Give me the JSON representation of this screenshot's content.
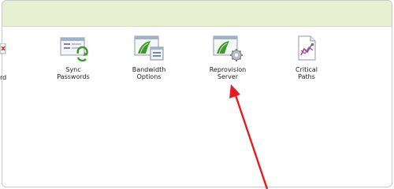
{
  "toolbar": {
    "partial_label": "rd",
    "tools": [
      {
        "line1": "Sync",
        "line2": "Passwords",
        "icon": "sync-passwords-icon"
      },
      {
        "line1": "Bandwidth",
        "line2": "Options",
        "icon": "bandwidth-options-icon"
      },
      {
        "line1": "Reprovision",
        "line2": "Server",
        "icon": "reprovision-server-icon"
      },
      {
        "line1": "Critical",
        "line2": "Paths",
        "icon": "critical-paths-icon"
      }
    ]
  },
  "colors": {
    "header": "#e8f0d2",
    "arrow": "#e8191f",
    "accent_green": "#3a9a2a"
  }
}
